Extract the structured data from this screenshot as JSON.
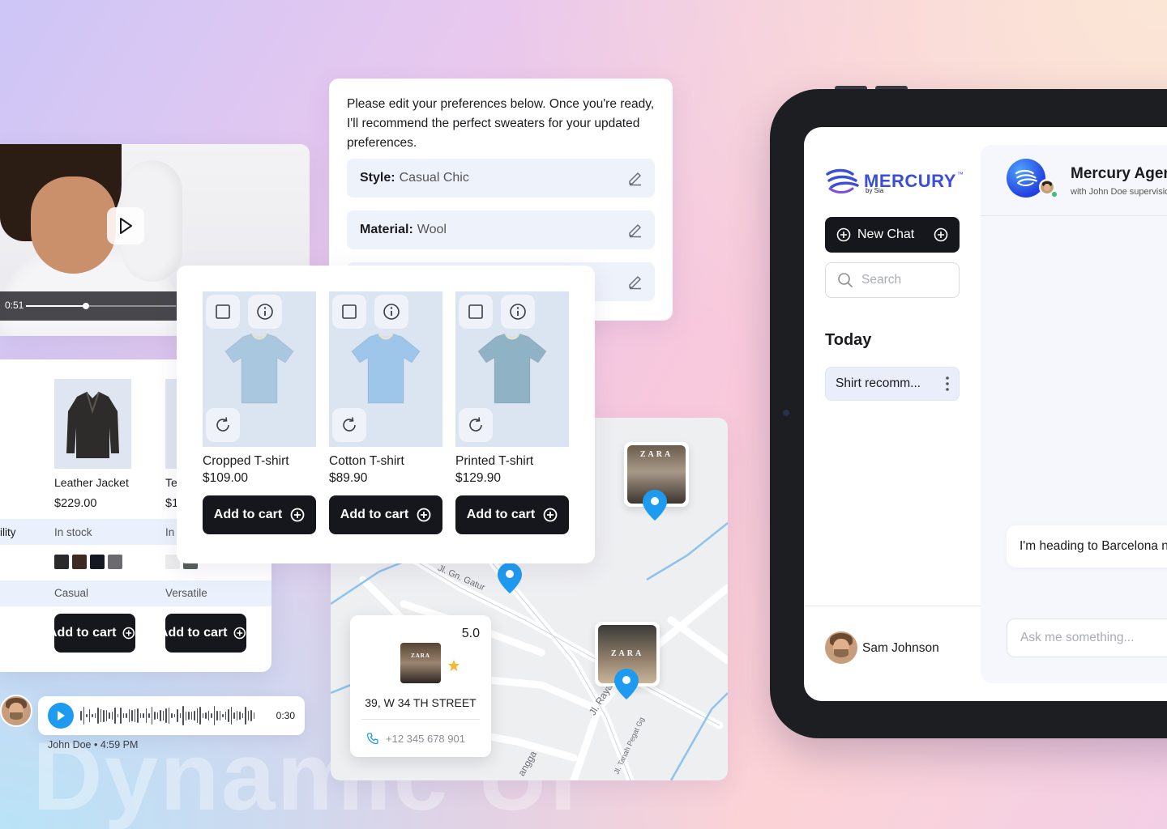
{
  "video": {
    "time": "0:51",
    "progress": 0.4
  },
  "preferences": {
    "intro": "Please edit your preferences below. Once you're ready, I'll recommend the perfect sweaters for your updated preferences.",
    "rows": [
      {
        "key": "Style:",
        "value": "Casual Chic"
      },
      {
        "key": "Material:",
        "value": "Wool"
      },
      {
        "key": "",
        "value": ""
      }
    ]
  },
  "comparison": {
    "row_label": "ility",
    "items": [
      {
        "name": "Leather Jacket",
        "price": "$229.00",
        "availability": "In stock",
        "style": "Casual",
        "button": "Add to cart",
        "swatches": [
          "#2a2a2a",
          "#3e2a22",
          "#141822",
          "#6b6b6f"
        ]
      },
      {
        "name": "Te",
        "price": "$1",
        "availability": "In",
        "style": "Versatile",
        "button": "Add to cart",
        "swatches": [
          "#ececec",
          "#56605a"
        ]
      }
    ]
  },
  "products": [
    {
      "name": "Cropped T-shirt",
      "price": "$109.00",
      "button": "Add to cart",
      "color": "#a9c7df"
    },
    {
      "name": "Cotton T-shirt",
      "price": "$89.90",
      "button": "Add to cart",
      "color": "#9dc6ea"
    },
    {
      "name": "Printed T-shirt",
      "price": "$129.90",
      "button": "Add to cart",
      "color": "#8fb2c4"
    }
  ],
  "map": {
    "streets": [
      "Jl. Gn. Gatur",
      "Jl. Raya Yeh Gan",
      "Jl. Tanah Pegat Gg",
      "angga"
    ],
    "store": {
      "sign": "ZARA",
      "rating": "5.0",
      "address": "39, W 34 TH STREET",
      "phone": "+12 345 678 901"
    },
    "accent": "#1d9bf0"
  },
  "voice": {
    "duration": "0:30",
    "sender": "John Doe",
    "time": "4:59 PM"
  },
  "watermark": "Dynamic UI",
  "app": {
    "logo": "MERCURY",
    "logo_tm": "™",
    "logo_sub": "by Sia",
    "new_chat": "New Chat",
    "search_placeholder": "Search",
    "section": "Today",
    "chat_items": [
      "Shirt recomm..."
    ],
    "user": "Sam Johnson",
    "agent_name": "Mercury Agent",
    "agent_sub": "with John Doe supervision",
    "message": "I'm heading to Barcelona next week",
    "input_placeholder": "Ask me something...",
    "brand_color": "#3a4ddb"
  }
}
